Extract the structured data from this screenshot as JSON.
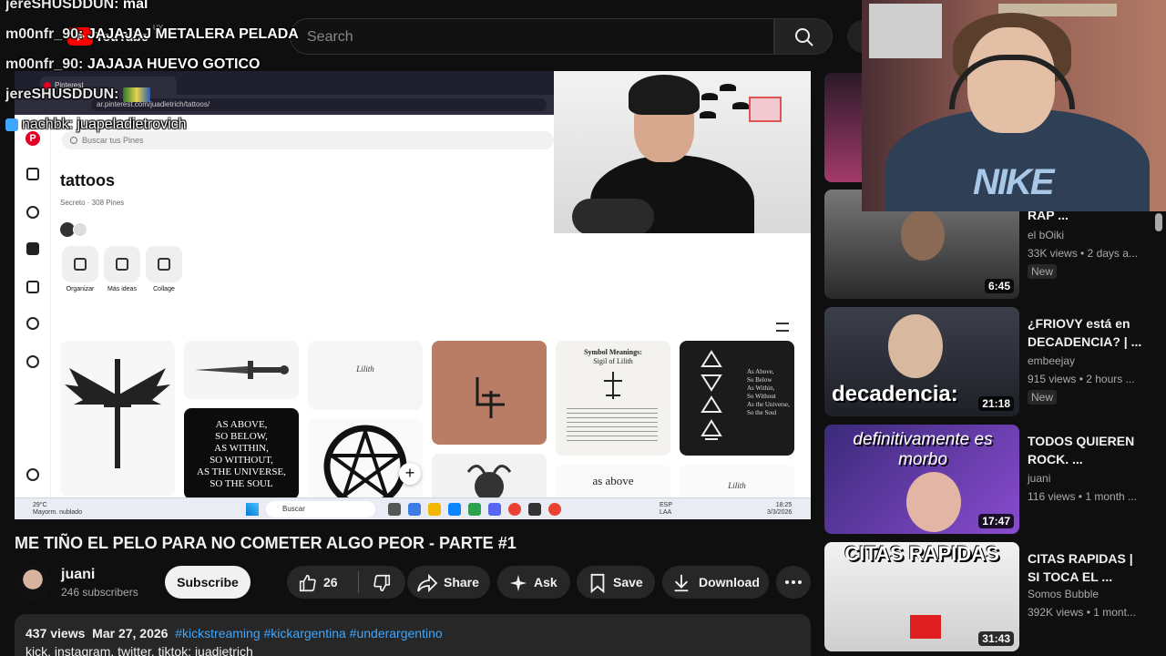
{
  "header": {
    "logo_text": "YouTube",
    "logo_country": "UY",
    "search_placeholder": "Search"
  },
  "chat": [
    {
      "user": "jereSHUSDDUN:",
      "message": "mal"
    },
    {
      "user": "m00nfr_90:",
      "message": "JAJAJAJ METALERA PELADA"
    },
    {
      "user": "m00nfr_90:",
      "message": "JAJAJA HUEVO GOTICO"
    },
    {
      "user": "jereSHUSDDUN:",
      "message": ""
    },
    {
      "user": "nachbk:",
      "message": "juapeladietrovich"
    }
  ],
  "browser": {
    "tab_title": "Pinterest",
    "url": "ar.pinterest.com/juadietrich/tattoos/"
  },
  "pinterest": {
    "logo": "P",
    "search_placeholder": "Buscar tus Pines",
    "board_title": "tattoos",
    "board_meta": "Secreto · 308 Pines",
    "actions": [
      "Organizar",
      "Más ideas",
      "Collage"
    ],
    "pins": {
      "lilith": "Lilith",
      "as_above": [
        "AS ABOVE,",
        "SO BELOW,",
        "AS WITHIN,",
        "SO WITHOUT,",
        "AS THE UNIVERSE,",
        "SO THE SOUL"
      ],
      "symbol_title": "Symbol Meanings:",
      "symbol_subtitle": "Sigil of Lilith",
      "table_text": [
        "As Above,",
        "So Below",
        "As Within,",
        "So Without",
        "As the Universe,",
        "So the Soul"
      ],
      "as_above_small": "as above",
      "lilith_small": "Lilith"
    }
  },
  "taskbar": {
    "weather_temp": "29°C",
    "weather_desc": "Mayorm. nublado",
    "search": "Buscar",
    "lang": "ESP",
    "lang2": "LAA",
    "time": "18:25",
    "date": "3/3/2026"
  },
  "video": {
    "title": "ME TIÑO EL PELO PARA NO COMETER ALGO PEOR - PARTE #1",
    "channel": "juani",
    "subscribers": "246 subscribers",
    "subscribe_label": "Subscribe",
    "likes": "26",
    "share_label": "Share",
    "ask_label": "Ask",
    "save_label": "Save",
    "download_label": "Download"
  },
  "description": {
    "views": "437 views",
    "date": "Mar 27, 2026",
    "tags": "#kickstreaming #kickargentina #underargentino",
    "text": "kick, instagram, twitter, tiktok: juadietrich"
  },
  "recommendations": [
    {
      "title": "RAP ...",
      "channel": "el bOiki",
      "stats": "33K views • 2 days a...",
      "badge": "New",
      "duration": "6:45"
    },
    {
      "title": "¿FRIOVY está en DECADENCIA? | ...",
      "channel": "embeejay",
      "stats": "915 views • 2 hours ...",
      "badge": "New",
      "duration": "21:18",
      "overlay": "decadencia:"
    },
    {
      "title": "TODOS QUIEREN ROCK. ...",
      "channel": "juani",
      "stats": "116 views • 1 month ...",
      "badge": "",
      "duration": "17:47",
      "overlay": "definitivamente es morbo"
    },
    {
      "title": "CITAS RAPIDAS | SI TOCA EL ...",
      "channel": "Somos Bubble",
      "stats": "392K views • 1 mont...",
      "badge": "",
      "duration": "31:43",
      "overlay": "CITAS RAPIDAS"
    }
  ],
  "colors": {
    "background": "#0f0f0f",
    "accent_link": "#3ea6ff",
    "youtube_red": "#ff0000",
    "pinterest_red": "#e60023"
  }
}
